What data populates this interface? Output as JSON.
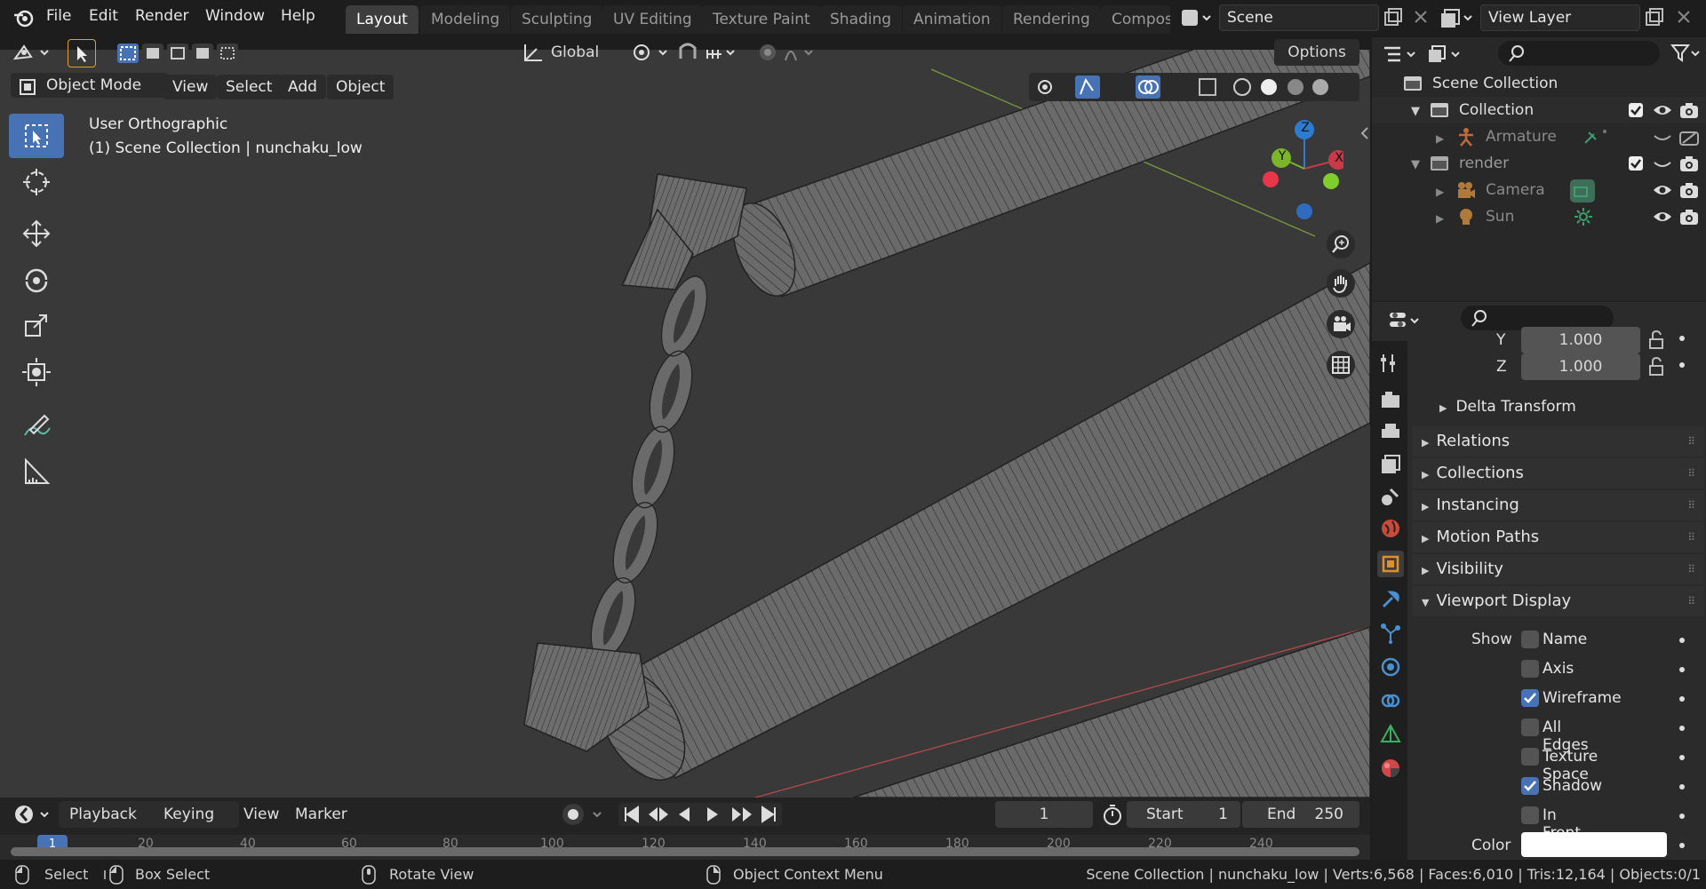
{
  "menu": {
    "items": [
      "File",
      "Edit",
      "Render",
      "Window",
      "Help"
    ]
  },
  "workspaces": [
    "Layout",
    "Modeling",
    "Sculpting",
    "UV Editing",
    "Texture Paint",
    "Shading",
    "Animation",
    "Rendering",
    "Compos"
  ],
  "scene": {
    "name": "Scene"
  },
  "view_layer": {
    "name": "View Layer"
  },
  "header": {
    "transform": "Global",
    "options": "Options"
  },
  "viewport": {
    "mode": "Object Mode",
    "menus": [
      "View",
      "Select",
      "Add",
      "Object"
    ],
    "overlay_title": "User Orthographic",
    "overlay_subtitle": "(1) Scene Collection | nunchaku_low",
    "gizmo": {
      "x": "X",
      "y": "Y",
      "z": "Z"
    }
  },
  "outliner": {
    "root": "Scene Collection",
    "rows": [
      {
        "label": "Collection"
      },
      {
        "label": "Armature"
      },
      {
        "label": "render"
      },
      {
        "label": "Camera"
      },
      {
        "label": "Sun"
      }
    ]
  },
  "properties": {
    "scale_y_label": "Y",
    "scale_y": "1.000",
    "scale_z_label": "Z",
    "scale_z": "1.000",
    "delta": "Delta Transform",
    "panels": [
      "Relations",
      "Collections",
      "Instancing",
      "Motion Paths",
      "Visibility",
      "Viewport Display"
    ],
    "show_label": "Show",
    "checks": [
      {
        "label": "Name",
        "on": false
      },
      {
        "label": "Axis",
        "on": false
      },
      {
        "label": "Wireframe",
        "on": true
      },
      {
        "label": "All Edges",
        "on": false
      },
      {
        "label": "Texture Space",
        "on": false
      },
      {
        "label": "Shadow",
        "on": true
      },
      {
        "label": "In Front",
        "on": false
      }
    ],
    "color_label": "Color"
  },
  "timeline": {
    "menus": [
      "Playback",
      "Keying",
      "View",
      "Marker"
    ],
    "current_frame": "1",
    "start_label": "Start",
    "start": "1",
    "end_label": "End",
    "end": "250",
    "ruler": [
      "1",
      "20",
      "40",
      "60",
      "80",
      "100",
      "120",
      "140",
      "160",
      "180",
      "200",
      "220",
      "240"
    ]
  },
  "status": {
    "select": "Select",
    "box_select": "Box Select",
    "rotate": "Rotate View",
    "context": "Object Context Menu",
    "stats": "Scene Collection | nunchaku_low | Verts:6,568 | Faces:6,010 | Tris:12,164 | Objects:0/1"
  },
  "colors": {
    "accent": "#4772b3",
    "viewport_bg": "#393939",
    "x_axis": "#c83a48",
    "y_axis": "#7bb52a",
    "z_axis": "#2e7bd0"
  }
}
